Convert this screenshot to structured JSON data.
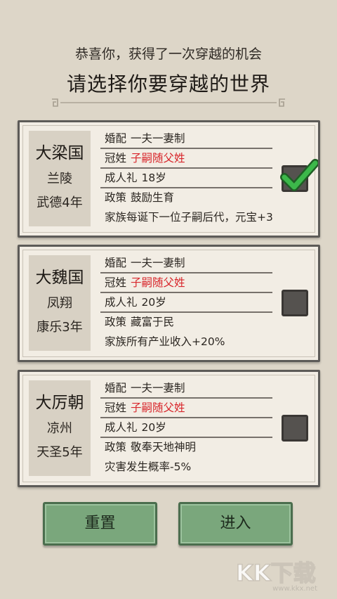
{
  "header": {
    "subtitle": "恭喜你，获得了一次穿越的机会",
    "title": "请选择你要穿越的世界"
  },
  "worlds": [
    {
      "nation": "大梁国",
      "city": "兰陵",
      "era": "武德4年",
      "rows": [
        {
          "key": "婚配",
          "value": "一夫一妻制"
        },
        {
          "key": "冠姓",
          "value": "子嗣随父姓"
        },
        {
          "key": "成人礼",
          "value": "18岁"
        },
        {
          "key": "政策",
          "value": "鼓励生育"
        }
      ],
      "effect": "家族每诞下一位子嗣后代，元宝+3",
      "selected": true
    },
    {
      "nation": "大魏国",
      "city": "凤翔",
      "era": "康乐3年",
      "rows": [
        {
          "key": "婚配",
          "value": "一夫一妻制"
        },
        {
          "key": "冠姓",
          "value": "子嗣随父姓"
        },
        {
          "key": "成人礼",
          "value": "20岁"
        },
        {
          "key": "政策",
          "value": "藏富于民"
        }
      ],
      "effect": "家族所有产业收入+20%",
      "selected": false
    },
    {
      "nation": "大厉朝",
      "city": "凉州",
      "era": "天圣5年",
      "rows": [
        {
          "key": "婚配",
          "value": "一夫一妻制"
        },
        {
          "key": "冠姓",
          "value": "子嗣随父姓"
        },
        {
          "key": "成人礼",
          "value": "20岁"
        },
        {
          "key": "政策",
          "value": "敬奉天地神明"
        }
      ],
      "effect": "灾害发生概率-5%",
      "selected": false
    }
  ],
  "buttons": {
    "reset": "重置",
    "enter": "进入"
  },
  "watermark": {
    "text": "KK下载",
    "url": "www.kkx.net"
  },
  "colors": {
    "background": "#ddd6c8",
    "card": "#f2ede4",
    "highlight_red": "#d8262b",
    "button_green": "#7aa77c",
    "check_green": "#3cb84a"
  }
}
